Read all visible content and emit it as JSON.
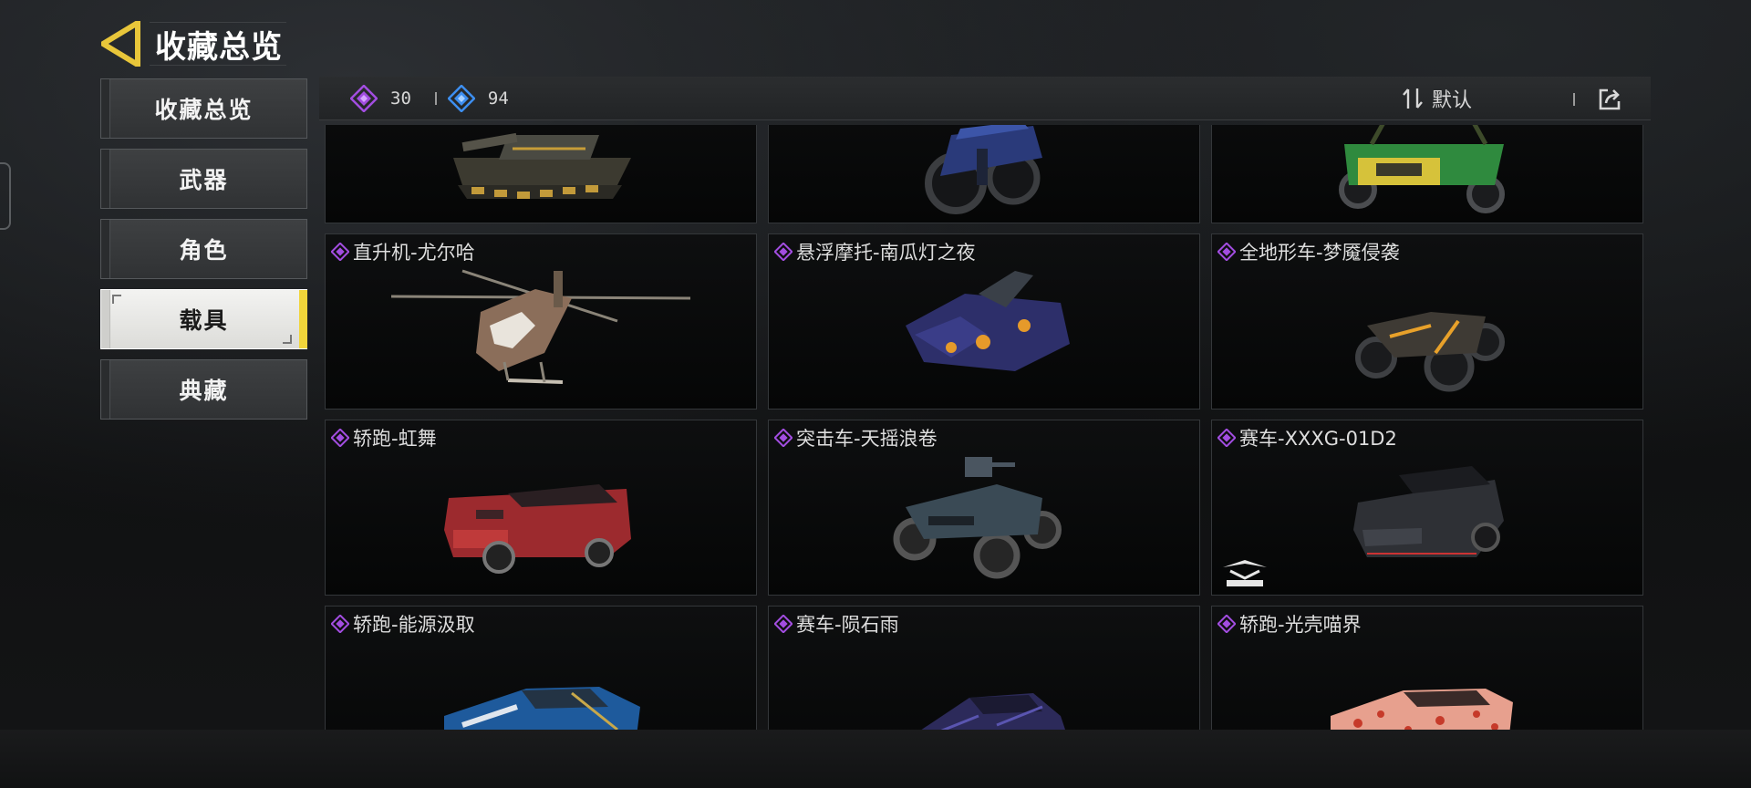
{
  "header": {
    "title": "收藏总览",
    "back_icon": "back-arrow-icon"
  },
  "sidebar": {
    "items": [
      {
        "label": "收藏总览",
        "active": false
      },
      {
        "label": "武器",
        "active": false
      },
      {
        "label": "角色",
        "active": false
      },
      {
        "label": "载具",
        "active": true
      },
      {
        "label": "典藏",
        "active": false
      }
    ]
  },
  "topbar": {
    "currency_purple": {
      "icon": "purple-diamond-icon",
      "value": "30"
    },
    "currency_blue": {
      "icon": "blue-diamond-icon",
      "value": "94"
    },
    "sort_label": "默认",
    "sort_icon": "sort-arrows-icon",
    "share_icon": "share-icon"
  },
  "colors": {
    "accent_yellow": "#f1d53a",
    "rarity_purple": "#a24de0",
    "rarity_blue": "#3d8ef0"
  },
  "cards": [
    {
      "name": "",
      "vehicle": "tank",
      "rarity": "none"
    },
    {
      "name": "",
      "vehicle": "motorcycle",
      "rarity": "none"
    },
    {
      "name": "",
      "vehicle": "buggy",
      "rarity": "none"
    },
    {
      "name": "直升机-尤尔哈",
      "vehicle": "helicopter",
      "rarity": "purple"
    },
    {
      "name": "悬浮摩托-南瓜灯之夜",
      "vehicle": "hoverbike",
      "rarity": "purple"
    },
    {
      "name": "全地形车-梦魇侵袭",
      "vehicle": "atv",
      "rarity": "purple"
    },
    {
      "name": "轿跑-虹舞",
      "vehicle": "coupe-red",
      "rarity": "purple"
    },
    {
      "name": "突击车-天摇浪卷",
      "vehicle": "assault-truck",
      "rarity": "purple"
    },
    {
      "name": "赛车-XXXG-01D2",
      "vehicle": "racecar-dark",
      "rarity": "purple",
      "brand_mark": "gundam-logo-icon"
    },
    {
      "name": "轿跑-能源汲取",
      "vehicle": "coupe-blue",
      "rarity": "purple"
    },
    {
      "name": "赛车-陨石雨",
      "vehicle": "racecar-purple",
      "rarity": "purple"
    },
    {
      "name": "轿跑-光壳喵界",
      "vehicle": "coupe-pattern",
      "rarity": "purple"
    }
  ]
}
